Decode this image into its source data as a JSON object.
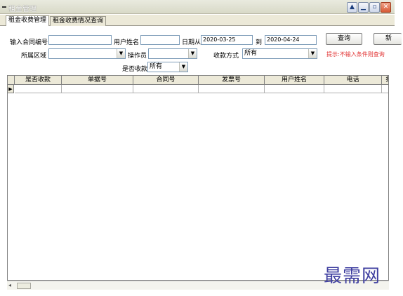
{
  "window": {
    "title": "租金管理",
    "buttons": {
      "minimize": "▁",
      "restore": "▫",
      "close": "✕",
      "help": "▲"
    }
  },
  "tabs": [
    {
      "label": "租金收费管理",
      "active": true
    },
    {
      "label": "租金收费情况查询",
      "active": false
    }
  ],
  "form": {
    "contract_no_label": "输入合同编号",
    "contract_no_value": "",
    "username_label": "用户姓名",
    "username_value": "",
    "date_from_label": "日期从",
    "date_from_value": "2020-03-25",
    "date_to_label": "到",
    "date_to_value": "2020-04-24",
    "query_button": "查询",
    "extra_button": "新",
    "area_label": "所属区域",
    "area_value": "",
    "operator_label": "操作员",
    "operator_value": "",
    "pay_method_label": "收款方式",
    "pay_method_value": "所有",
    "hint": "提示:不输入条件则查询",
    "collected_label": "是否收款",
    "collected_value": "所有"
  },
  "grid": {
    "columns": [
      "是否收款",
      "单据号",
      "合同号",
      "发票号",
      "用户姓名",
      "电话",
      "摘要"
    ],
    "row_indicator": "▶"
  },
  "watermark": "最需网",
  "colors": {
    "hint_red": "#e23434",
    "watermark_blue": "#3f3fa0",
    "input_border": "#7f9db9"
  }
}
